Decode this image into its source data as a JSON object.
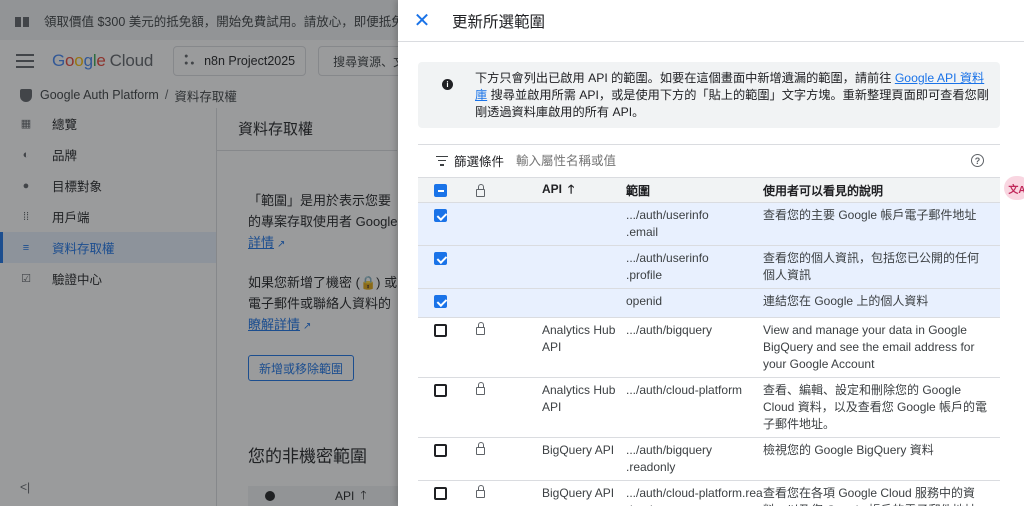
{
  "promo": {
    "text": "領取價值 $300 美元的抵免額，開始免費試用。請放心，即便抵免額"
  },
  "topbar": {
    "logo": {
      "g": "G",
      "o1": "o",
      "o2": "o",
      "g2": "g",
      "l": "l",
      "e": "e",
      "cloud": "Cloud"
    },
    "project": "n8n Project2025",
    "search": "搜尋資源、文"
  },
  "breadcrumb": {
    "root": "Google Auth Platform",
    "sep": "/",
    "current": "資料存取權"
  },
  "sidebar": {
    "items": [
      {
        "label": "總覽",
        "icon": "dashboard-icon"
      },
      {
        "label": "品牌",
        "icon": "palette-icon"
      },
      {
        "label": "目標對象",
        "icon": "person-icon"
      },
      {
        "label": "用戶端",
        "icon": "grid-icon"
      },
      {
        "label": "資料存取權",
        "icon": "data-access-icon"
      },
      {
        "label": "驗證中心",
        "icon": "verified-icon"
      }
    ],
    "collapse": "<|"
  },
  "main": {
    "title": "資料存取權",
    "para1_line1": "「範圍」是用於表示您要",
    "para1_line2": "的專案存取使用者 Google",
    "para1_link": "詳情",
    "para2_line1": "如果您新增了機密 (🔒) 或",
    "para2_line2": "電子郵件或聯絡人資料的",
    "para2_link": "瞭解詳情",
    "manage_button": "新增或移除範圍",
    "nonsensitive_title": "您的非機密範圍",
    "bg_table_api": "API"
  },
  "panel": {
    "title": "更新所選範圍",
    "info_text_before": "下方只會列出已啟用 API 的範圍。如要在這個畫面中新增遺漏的範圍，請前往 ",
    "info_link": "Google API 資料庫",
    "info_text_after": " 搜尋並啟用所需 API，或是使用下方的「貼上的範圍」文字方塊。重新整理頁面即可查看您剛剛透過資料庫啟用的所有 API。",
    "filter_label": "篩選條件",
    "filter_placeholder": "輸入屬性名稱或值",
    "columns": {
      "api": "API",
      "scope": "範圍",
      "description": "使用者可以看見的說明"
    },
    "rows": [
      {
        "checked": true,
        "sensitive": false,
        "api": "",
        "scope": ".../auth/userinfo\n.email",
        "description": "查看您的主要 Google 帳戶電子郵件地址"
      },
      {
        "checked": true,
        "sensitive": false,
        "api": "",
        "scope": ".../auth/userinfo\n.profile",
        "description": "查看您的個人資訊，包括您已公開的任何個人資訊"
      },
      {
        "checked": true,
        "sensitive": false,
        "api": "",
        "scope": "openid",
        "description": "連結您在 Google 上的個人資料"
      },
      {
        "checked": false,
        "sensitive": true,
        "api": "Analytics Hub API",
        "scope": ".../auth/bigquery",
        "description": "View and manage your data in Google BigQuery and see the email address for your Google Account"
      },
      {
        "checked": false,
        "sensitive": true,
        "api": "Analytics Hub API",
        "scope": ".../auth/cloud-platform",
        "description": "查看、編輯、設定和刪除您的 Google Cloud 資料，以及查看您 Google 帳戶的電子郵件地址。"
      },
      {
        "checked": false,
        "sensitive": true,
        "api": "BigQuery API",
        "scope": ".../auth/bigquery\n.readonly",
        "description": "檢視您的 Google BigQuery 資料"
      },
      {
        "checked": false,
        "sensitive": true,
        "api": "BigQuery API",
        "scope": ".../auth/cloud-platform.read-only",
        "description": "查看您在各項 Google Cloud 服務中的資料，以及您 Google 帳戶的電子郵件地址"
      }
    ]
  },
  "translate_badge": "文A"
}
